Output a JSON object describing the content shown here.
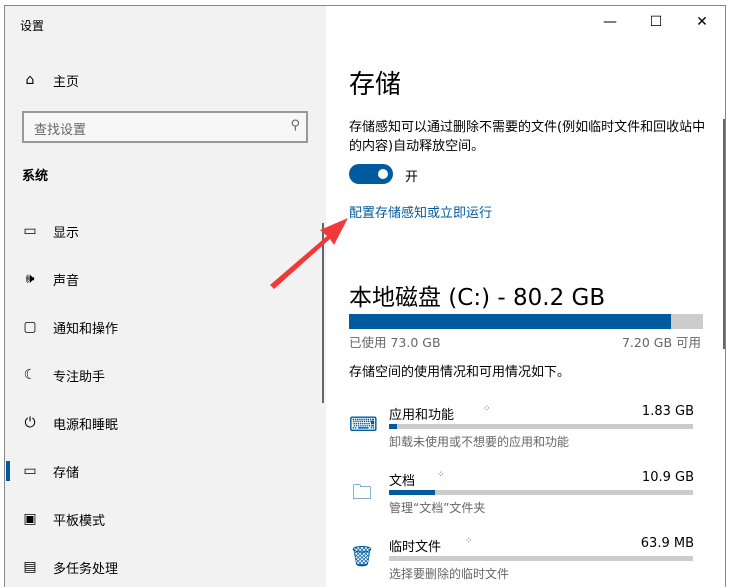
{
  "window": {
    "title": "设置",
    "minimize": "—",
    "maximize": "☐",
    "close": "✕"
  },
  "sidebar": {
    "home": "主页",
    "search_placeholder": "查找设置",
    "section": "系统",
    "items": [
      {
        "label": "显示",
        "icon": "monitor-icon",
        "glyph": "▭"
      },
      {
        "label": "声音",
        "icon": "speaker-icon",
        "glyph": "🕪"
      },
      {
        "label": "通知和操作",
        "icon": "notification-icon",
        "glyph": "▢"
      },
      {
        "label": "专注助手",
        "icon": "moon-icon",
        "glyph": "☾"
      },
      {
        "label": "电源和睡眠",
        "icon": "power-icon",
        "glyph": "⏻"
      },
      {
        "label": "存储",
        "icon": "storage-icon",
        "glyph": "▭"
      },
      {
        "label": "平板模式",
        "icon": "tablet-icon",
        "glyph": "▣"
      },
      {
        "label": "多任务处理",
        "icon": "multitask-icon",
        "glyph": "▤"
      }
    ],
    "selected": "存储"
  },
  "main": {
    "title": "存储",
    "description": "存储感知可以通过删除不需要的文件(例如临时文件和回收站中的内容)自动释放空间。",
    "toggle_label": "开",
    "toggle_on": true,
    "config_link": "配置存储感知或立即运行",
    "disk_title": "本地磁盘 (C:) - 80.2 GB",
    "used": "已使用 73.0 GB",
    "free": "7.20 GB 可用",
    "used_fraction": 0.91,
    "note": "存储空间的使用情况和可用情况如下。",
    "categories": [
      {
        "name": "应用和功能",
        "size": "1.83 GB",
        "sub": "卸载未使用或不想要的应用和功能",
        "fraction": 0.025,
        "icon": "keyboard-icon"
      },
      {
        "name": "文档",
        "size": "10.9 GB",
        "sub": "管理“文档”文件夹",
        "fraction": 0.15,
        "icon": "folder-icon"
      },
      {
        "name": "临时文件",
        "size": "63.9 MB",
        "sub": "选择要删除的临时文件",
        "fraction": 0,
        "icon": "trash-icon"
      }
    ],
    "accent": "#005a9e"
  }
}
